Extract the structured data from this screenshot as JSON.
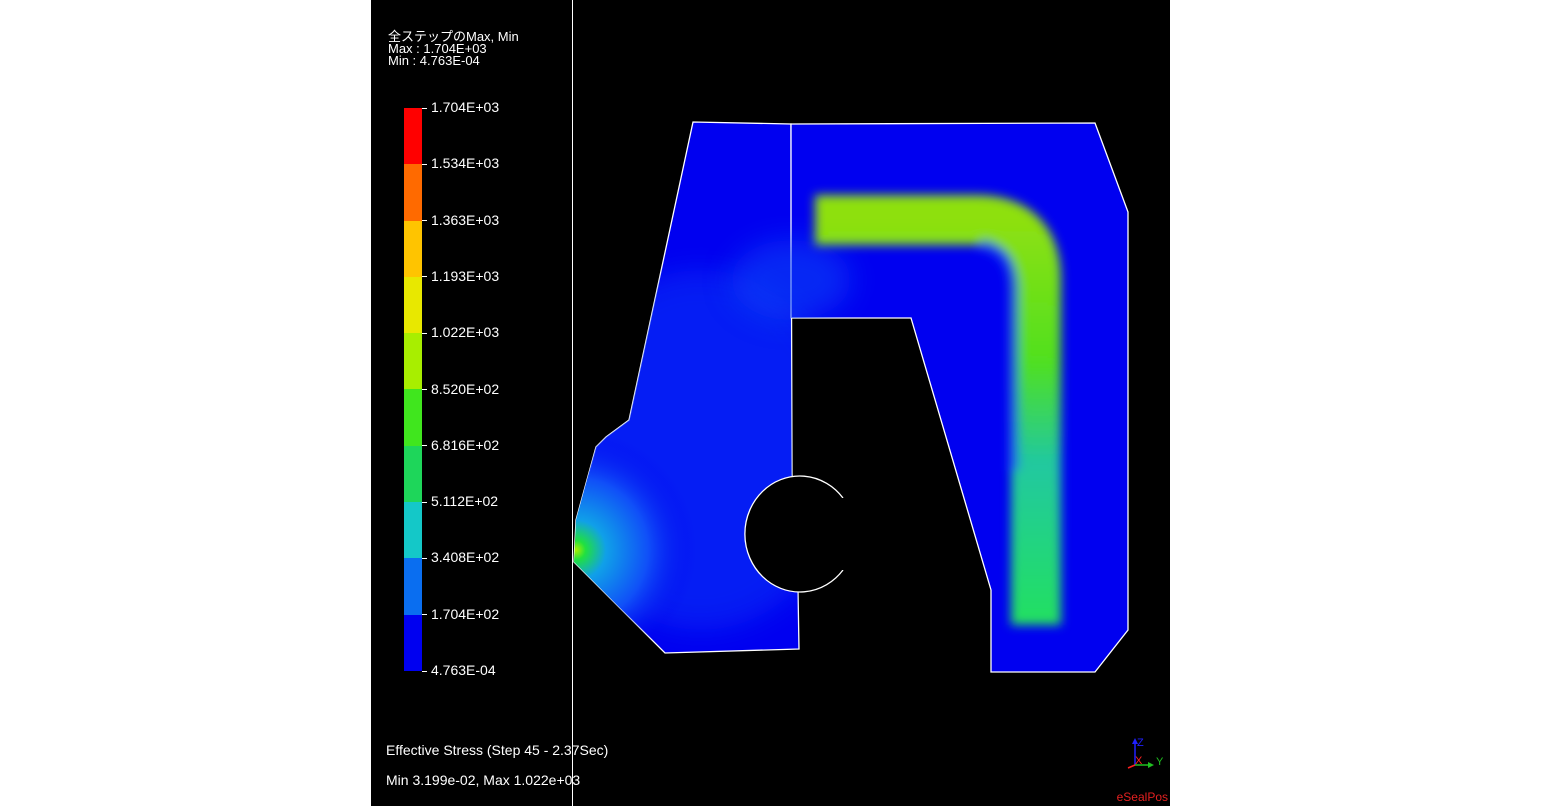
{
  "header": {
    "title": "全ステップのMax, Min",
    "max_line": "Max : 1.704E+03",
    "min_line": "Min : 4.763E-04"
  },
  "legend": {
    "labels": [
      "1.704E+03",
      "1.534E+03",
      "1.363E+03",
      "1.193E+03",
      "1.022E+03",
      "8.520E+02",
      "6.816E+02",
      "5.112E+02",
      "3.408E+02",
      "1.704E+02",
      "4.763E-04"
    ],
    "colors": [
      "#ff0000",
      "#ff6a00",
      "#ffc400",
      "#e8e800",
      "#a8ee00",
      "#40e61e",
      "#1ed65a",
      "#14c8c8",
      "#0a6ef0",
      "#0000f0"
    ]
  },
  "caption": {
    "result": "Effective Stress (Step 45 - 2.37Sec)",
    "range": "Min 3.199e-02, Max 1.022e+03"
  },
  "axes": {
    "z": "Z",
    "x": "X",
    "y": "Y"
  },
  "brand": "eSealPos"
}
